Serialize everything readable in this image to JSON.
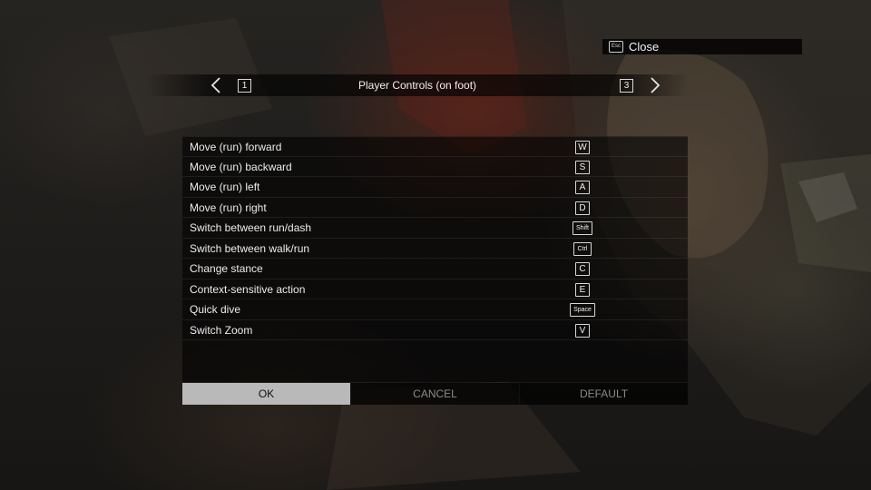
{
  "close": {
    "key": "Esc",
    "label": "Close"
  },
  "header": {
    "title": "Player Controls (on foot)",
    "prev_page_key": "1",
    "next_page_key": "3"
  },
  "controls": [
    {
      "action": "Move (run) forward",
      "key": "W"
    },
    {
      "action": "Move (run) backward",
      "key": "S"
    },
    {
      "action": "Move (run) left",
      "key": "A"
    },
    {
      "action": "Move (run) right",
      "key": "D"
    },
    {
      "action": "Switch between run/dash",
      "key": "Shift"
    },
    {
      "action": "Switch between walk/run",
      "key": "Ctrl"
    },
    {
      "action": "Change stance",
      "key": "C"
    },
    {
      "action": "Context-sensitive action",
      "key": "E"
    },
    {
      "action": "Quick dive",
      "key": "Space"
    },
    {
      "action": "Switch Zoom",
      "key": "V"
    }
  ],
  "buttons": {
    "ok": "OK",
    "cancel": "CANCEL",
    "default": "DEFAULT",
    "selected": "ok"
  },
  "colors": {
    "selected_button_bg": "#b9b9b9",
    "panel_bg": "rgba(0,0,0,0.58)"
  }
}
